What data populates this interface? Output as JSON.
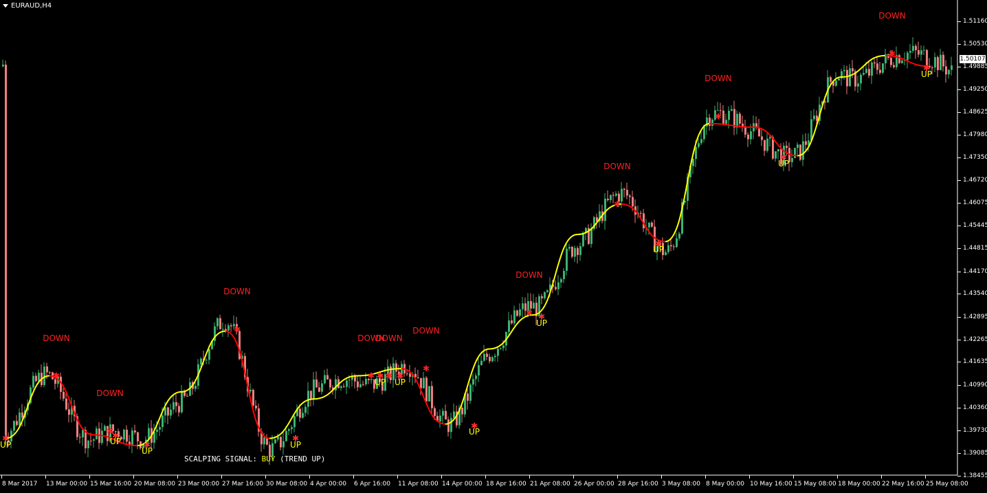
{
  "window": {
    "symbol_label": "EURAUD,H4"
  },
  "price_axis": {
    "labels": [
      "1.51160",
      "1.50530",
      "1.49885",
      "1.49250",
      "1.48625",
      "1.47980",
      "1.47350",
      "1.46720",
      "1.46075",
      "1.45445",
      "1.44815",
      "1.44170",
      "1.43540",
      "1.42895",
      "1.42265",
      "1.41635",
      "1.40990",
      "1.40360",
      "1.39730",
      "1.39085",
      "1.38455"
    ],
    "current_price": "1.50107"
  },
  "time_axis": {
    "labels": [
      "8 Mar 2017",
      "13 Mar 00:00",
      "15 Mar 16:00",
      "20 Mar 08:00",
      "23 Mar 00:00",
      "27 Mar 16:00",
      "30 Mar 08:00",
      "4 Apr 00:00",
      "6 Apr 16:00",
      "11 Apr 08:00",
      "14 Apr 00:00",
      "18 Apr 16:00",
      "21 Apr 08:00",
      "26 Apr 00:00",
      "28 Apr 16:00",
      "3 May 08:00",
      "8 May 00:00",
      "10 May 16:00",
      "15 May 08:00",
      "18 May 00:00",
      "22 May 16:00",
      "25 May 08:00"
    ]
  },
  "signals": {
    "down_label": "DOWN",
    "up_label": "UP"
  },
  "scalping": {
    "label": "SCALPING SIGNAL:",
    "value": "BUY",
    "trend": "(TREND UP)"
  },
  "colors": {
    "background": "#000000",
    "bull_candle": "#3cb371",
    "bear_candle": "#f08080",
    "trend_up_line": "#ffff00",
    "trend_down_line": "#ff0000",
    "down_text": "#ff2020",
    "up_text": "#ffff00"
  },
  "chart_data": {
    "type": "candlestick",
    "symbol": "EURAUD",
    "timeframe": "H4",
    "ylim": [
      1.383,
      1.516
    ],
    "trend_line": [
      {
        "t": "8 Mar 2017",
        "v": 1.395
      },
      {
        "t": "13 Mar 00:00",
        "v": 1.4125
      },
      {
        "t": "15 Mar 16:00",
        "v": 1.396
      },
      {
        "t": "20 Mar 08:00",
        "v": 1.393
      },
      {
        "t": "23 Mar 00:00",
        "v": 1.408
      },
      {
        "t": "27 Mar 16:00",
        "v": 1.425
      },
      {
        "t": "30 Mar 08:00",
        "v": 1.395
      },
      {
        "t": "4 Apr 00:00",
        "v": 1.406
      },
      {
        "t": "6 Apr 16:00",
        "v": 1.4125
      },
      {
        "t": "11 Apr 08:00",
        "v": 1.4145
      },
      {
        "t": "14 Apr 00:00",
        "v": 1.399
      },
      {
        "t": "18 Apr 16:00",
        "v": 1.42
      },
      {
        "t": "21 Apr 08:00",
        "v": 1.4295
      },
      {
        "t": "26 Apr 00:00",
        "v": 1.452
      },
      {
        "t": "28 Apr 16:00",
        "v": 1.4605
      },
      {
        "t": "3 May 08:00",
        "v": 1.45
      },
      {
        "t": "8 May 00:00",
        "v": 1.483
      },
      {
        "t": "10 May 16:00",
        "v": 1.482
      },
      {
        "t": "15 May 08:00",
        "v": 1.474
      },
      {
        "t": "18 May 00:00",
        "v": 1.496
      },
      {
        "t": "22 May 16:00",
        "v": 1.502
      },
      {
        "t": "25 May 08:00",
        "v": 1.499
      }
    ],
    "signals": [
      {
        "type": "UP",
        "v": 1.395
      },
      {
        "type": "DOWN",
        "v": 1.4125
      },
      {
        "type": "DOWN",
        "v": 1.397
      },
      {
        "type": "UP",
        "v": 1.3958
      },
      {
        "type": "UP",
        "v": 1.3932
      },
      {
        "type": "DOWN",
        "v": 1.4255
      },
      {
        "type": "UP",
        "v": 1.395
      },
      {
        "type": "DOWN",
        "v": 1.4125
      },
      {
        "type": "UP",
        "v": 1.4125
      },
      {
        "type": "DOWN",
        "v": 1.4125
      },
      {
        "type": "UP",
        "v": 1.4125
      },
      {
        "type": "DOWN",
        "v": 1.4145
      },
      {
        "type": "UP",
        "v": 1.3985
      },
      {
        "type": "DOWN",
        "v": 1.43
      },
      {
        "type": "UP",
        "v": 1.429
      },
      {
        "type": "DOWN",
        "v": 1.4605
      },
      {
        "type": "UP",
        "v": 1.4495
      },
      {
        "type": "DOWN",
        "v": 1.485
      },
      {
        "type": "UP",
        "v": 1.4735
      },
      {
        "type": "DOWN",
        "v": 1.5025
      },
      {
        "type": "UP",
        "v": 1.4985
      }
    ],
    "last_price": 1.50107
  }
}
